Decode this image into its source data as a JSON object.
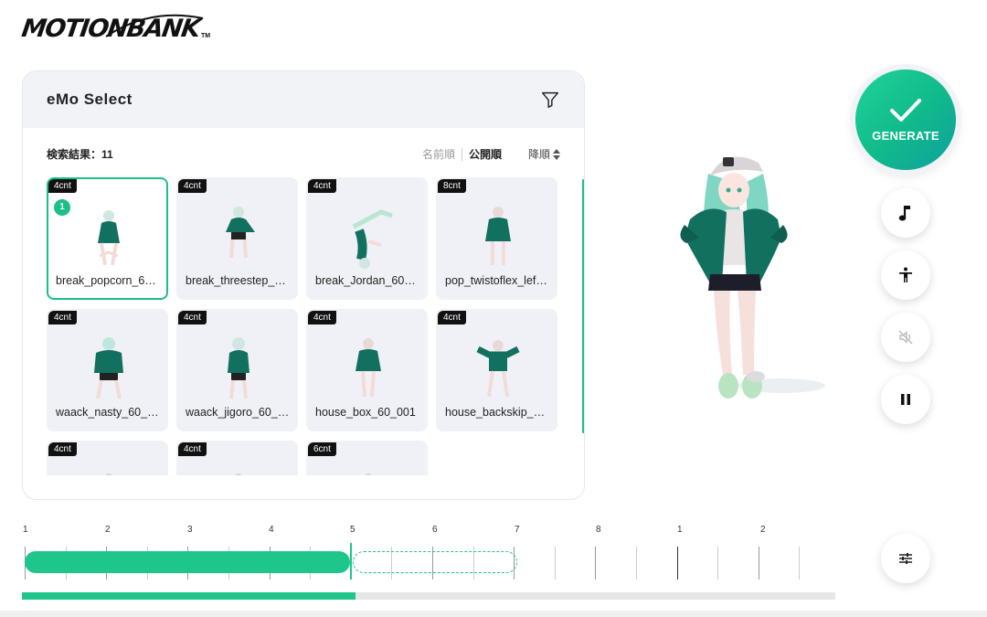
{
  "app": {
    "logo_text": "MOTIONBANK",
    "logo_tm": "TM"
  },
  "panel": {
    "title": "eMo Select",
    "result_label": "検索結果：11",
    "sort_options": [
      "名前順",
      "公開順"
    ],
    "sort_active": "公開順",
    "sort_order": "降順"
  },
  "cards": [
    {
      "cnt": "4cnt",
      "label": "break_popcorn_6…",
      "selected": true,
      "order": "1",
      "pose": "popcorn"
    },
    {
      "cnt": "4cnt",
      "label": "break_threestep_…",
      "pose": "threestep"
    },
    {
      "cnt": "4cnt",
      "label": "break_Jordan_60…",
      "pose": "jordan"
    },
    {
      "cnt": "8cnt",
      "label": "pop_twistoflex_lef…",
      "pose": "stand"
    },
    {
      "cnt": "4cnt",
      "label": "waack_nasty_60_…",
      "pose": "back"
    },
    {
      "cnt": "4cnt",
      "label": "waack_jigoro_60_…",
      "pose": "back2"
    },
    {
      "cnt": "4cnt",
      "label": "house_box_60_001",
      "pose": "box"
    },
    {
      "cnt": "4cnt",
      "label": "house_backskip_6…",
      "pose": "arms"
    },
    {
      "cnt": "4cnt",
      "label": "",
      "pose": "partial"
    },
    {
      "cnt": "4cnt",
      "label": "",
      "pose": "partial"
    },
    {
      "cnt": "6cnt",
      "label": "",
      "pose": "partial"
    }
  ],
  "controls": {
    "generate_label": "GENERATE",
    "buttons": [
      "music-note-icon",
      "person-icon",
      "mute-icon",
      "pause-icon",
      "sliders-icon"
    ]
  },
  "timeline": {
    "beats": [
      "1",
      "2",
      "3",
      "4",
      "5",
      "6",
      "7",
      "8",
      "1",
      "2"
    ],
    "progress": 0.41
  },
  "colors": {
    "accent": "#1ec68c",
    "accent_dark": "#0f9fa0"
  }
}
